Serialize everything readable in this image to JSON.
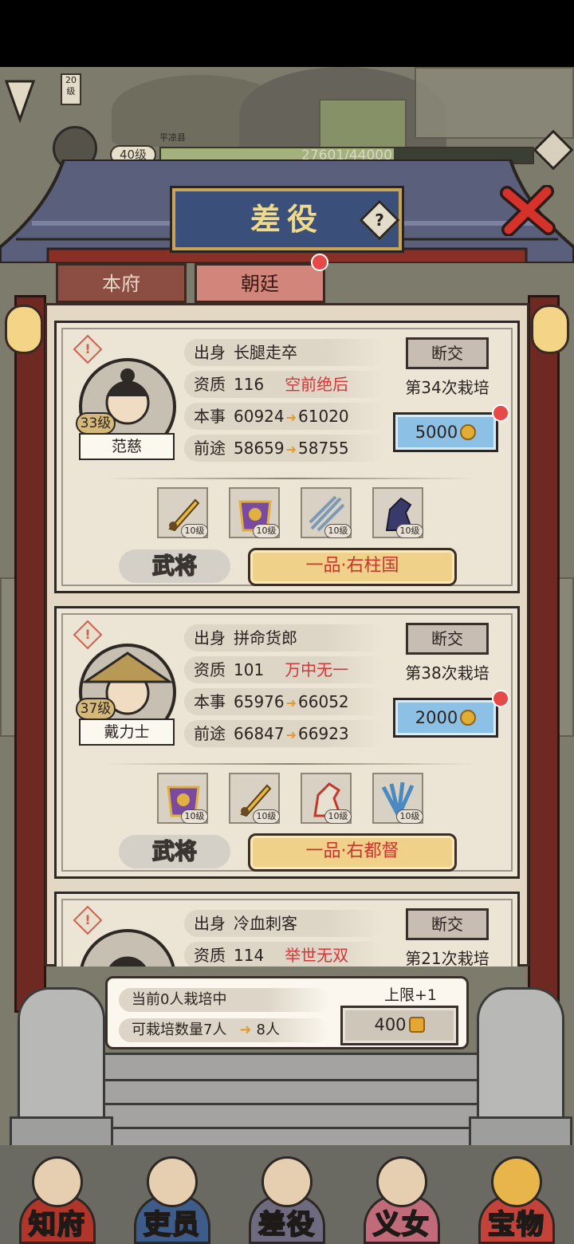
{
  "map": {
    "level_badge": "20\n级",
    "place_label": "平凉县"
  },
  "player": {
    "level": "40级",
    "exp": "27601/44000",
    "exp_fraction": 0.627
  },
  "dialog": {
    "title": "差役",
    "help_label": "?",
    "tabs": [
      {
        "label": "本府"
      },
      {
        "label": "朝廷"
      }
    ],
    "active_tab": "朝廷"
  },
  "cards": [
    {
      "warn": "!",
      "level": "33级",
      "name": "范慈",
      "origin_key": "出身",
      "origin": "长腿走卒",
      "quality_key": "资质",
      "quality": "116",
      "quality_grade": "空前绝后",
      "skill_key": "本事",
      "skill_from": "60924",
      "skill_to": "61020",
      "future_key": "前途",
      "future_from": "58659",
      "future_to": "58755",
      "cut_label": "断交",
      "train_count": "第34次栽培",
      "cost": "5000",
      "items": [
        {
          "icon": "golden-sword-icon",
          "level": "10级"
        },
        {
          "icon": "purple-armor-icon",
          "level": "10级"
        },
        {
          "icon": "spears-icon",
          "level": "10级"
        },
        {
          "icon": "dark-horse-icon",
          "level": "10级"
        }
      ],
      "role": "武将",
      "rank": "一品·右柱国"
    },
    {
      "warn": "!",
      "level": "37级",
      "name": "戴力士",
      "origin_key": "出身",
      "origin": "拼命货郎",
      "quality_key": "资质",
      "quality": "101",
      "quality_grade": "万中无一",
      "skill_key": "本事",
      "skill_from": "65976",
      "skill_to": "66052",
      "future_key": "前途",
      "future_from": "66847",
      "future_to": "66923",
      "cut_label": "断交",
      "train_count": "第38次栽培",
      "cost": "2000",
      "items": [
        {
          "icon": "purple-armor-icon",
          "level": "10级"
        },
        {
          "icon": "golden-sword-icon",
          "level": "10级"
        },
        {
          "icon": "red-horse-icon",
          "level": "10级"
        },
        {
          "icon": "feather-fan-icon",
          "level": "10级"
        }
      ],
      "role": "武将",
      "rank": "一品·右都督"
    },
    {
      "warn": "!",
      "origin_key": "出身",
      "origin": "冷血刺客",
      "quality_key": "资质",
      "quality": "114",
      "quality_grade": "举世无双",
      "cut_label": "断交",
      "train_count": "第21次栽培"
    }
  ],
  "status": {
    "current": "当前0人栽培中",
    "capacity": "可栽培数量7人",
    "capacity_next": "8人",
    "limit_label": "上限+1",
    "limit_cost": "400"
  },
  "nav": [
    {
      "label": "知府"
    },
    {
      "label": "吏员"
    },
    {
      "label": "差役"
    },
    {
      "label": "义女"
    },
    {
      "label": "宝物"
    }
  ],
  "colors": {
    "accent_red": "#d0383a",
    "gold": "#f0d18a",
    "cost_blue": "#8cc0e4",
    "plaque_blue": "#3a4f7a"
  }
}
